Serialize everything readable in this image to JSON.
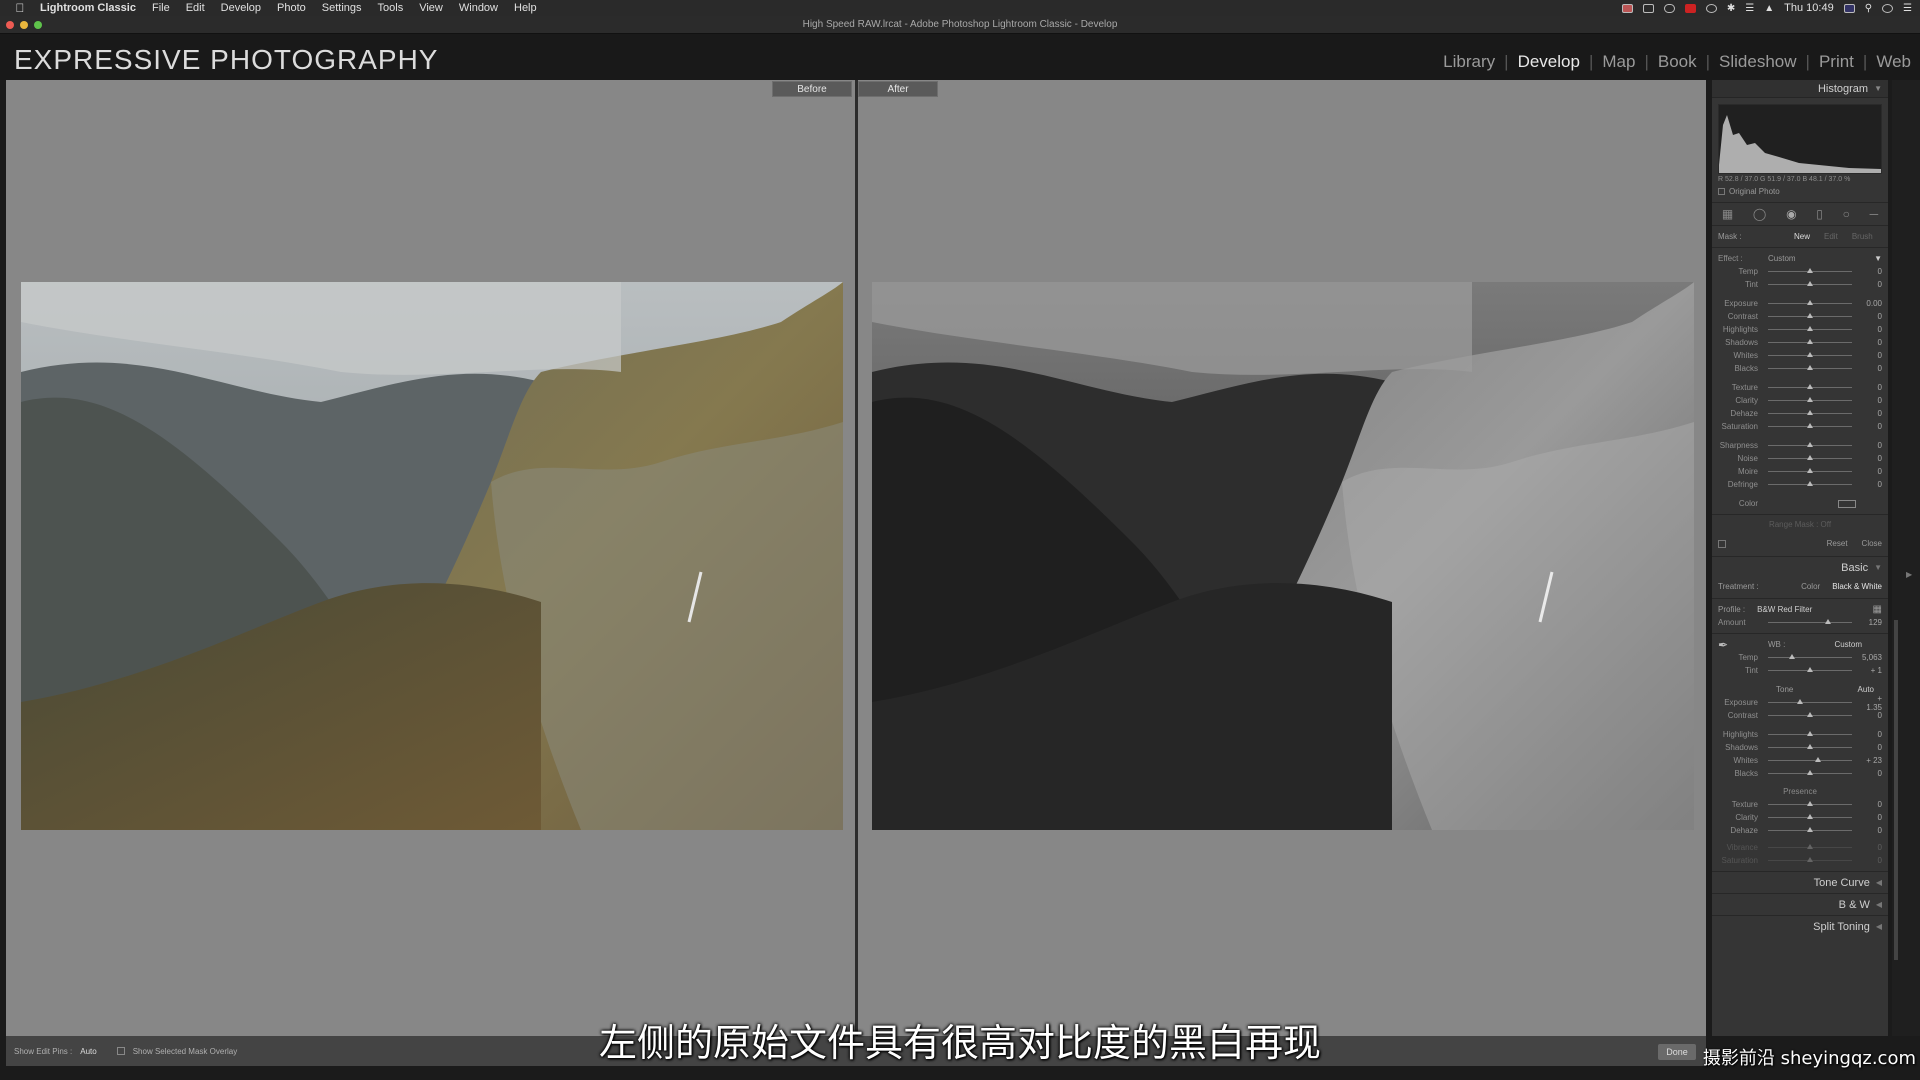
{
  "menubar": {
    "app_name": "Lightroom Classic",
    "items": [
      "File",
      "Edit",
      "Develop",
      "Photo",
      "Settings",
      "Tools",
      "View",
      "Window",
      "Help"
    ],
    "clock": "Thu 10:49"
  },
  "window": {
    "title": "High Speed RAW.lrcat - Adobe Photoshop Lightroom Classic - Develop"
  },
  "identity_plate": {
    "logo_text": "EXPRESSIVE PHOTOGRAPHY"
  },
  "modules": {
    "items": [
      "Library",
      "Develop",
      "Map",
      "Book",
      "Slideshow",
      "Print",
      "Web"
    ],
    "active": "Develop"
  },
  "view": {
    "before_label": "Before",
    "after_label": "After"
  },
  "toolbar": {
    "edit_pins_label": "Show Edit Pins :",
    "edit_pins_value": "Auto",
    "mask_overlay_label": "Show Selected Mask Overlay",
    "done_label": "Done"
  },
  "panel": {
    "histogram": {
      "title": "Histogram",
      "readout": "R 52.8 / 37.0  G 51.9 / 37.0  B 48.1 / 37.0 %",
      "original_photo_label": "Original Photo"
    },
    "mask": {
      "label": "Mask :",
      "new": "New",
      "edit": "Edit",
      "brush": "Brush",
      "effect_label": "Effect :",
      "effect_value": "Custom",
      "color_label": "Color",
      "range_mask_label": "Range Mask : Off",
      "reset_label": "Reset",
      "close_label": "Close",
      "sliders": [
        {
          "label": "Temp",
          "value": "0",
          "pos": 0.5
        },
        {
          "label": "Tint",
          "value": "0",
          "pos": 0.5
        },
        {
          "label": "Exposure",
          "value": "0.00",
          "pos": 0.5
        },
        {
          "label": "Contrast",
          "value": "0",
          "pos": 0.5
        },
        {
          "label": "Highlights",
          "value": "0",
          "pos": 0.5
        },
        {
          "label": "Shadows",
          "value": "0",
          "pos": 0.5
        },
        {
          "label": "Whites",
          "value": "0",
          "pos": 0.5
        },
        {
          "label": "Blacks",
          "value": "0",
          "pos": 0.5
        },
        {
          "label": "Texture",
          "value": "0",
          "pos": 0.5
        },
        {
          "label": "Clarity",
          "value": "0",
          "pos": 0.5
        },
        {
          "label": "Dehaze",
          "value": "0",
          "pos": 0.5
        },
        {
          "label": "Saturation",
          "value": "0",
          "pos": 0.5
        },
        {
          "label": "Sharpness",
          "value": "0",
          "pos": 0.5
        },
        {
          "label": "Noise",
          "value": "0",
          "pos": 0.5
        },
        {
          "label": "Moire",
          "value": "0",
          "pos": 0.5
        },
        {
          "label": "Defringe",
          "value": "0",
          "pos": 0.5
        }
      ]
    },
    "basic": {
      "title": "Basic",
      "treatment_label": "Treatment :",
      "treatment_color": "Color",
      "treatment_bw": "Black & White",
      "profile_label": "Profile :",
      "profile_value": "B&W Red Filter",
      "amount_label": "Amount",
      "amount_value": "129",
      "amount_pos": 0.72,
      "wb_label": "WB :",
      "wb_value": "Custom",
      "wb_sliders": [
        {
          "label": "Temp",
          "value": "5,063",
          "pos": 0.28
        },
        {
          "label": "Tint",
          "value": "+ 1",
          "pos": 0.5
        }
      ],
      "tone_label": "Tone",
      "tone_auto": "Auto",
      "tone_sliders": [
        {
          "label": "Exposure",
          "value": "+ 1.35",
          "pos": 0.38
        },
        {
          "label": "Contrast",
          "value": "0",
          "pos": 0.5
        }
      ],
      "tone_sliders2": [
        {
          "label": "Highlights",
          "value": "0",
          "pos": 0.5
        },
        {
          "label": "Shadows",
          "value": "0",
          "pos": 0.5
        },
        {
          "label": "Whites",
          "value": "+ 23",
          "pos": 0.6
        },
        {
          "label": "Blacks",
          "value": "0",
          "pos": 0.5
        }
      ],
      "presence_label": "Presence",
      "presence_sliders": [
        {
          "label": "Texture",
          "value": "0",
          "pos": 0.5
        },
        {
          "label": "Clarity",
          "value": "0",
          "pos": 0.5
        },
        {
          "label": "Dehaze",
          "value": "0",
          "pos": 0.5
        }
      ],
      "presence_dim_sliders": [
        {
          "label": "Vibrance",
          "value": "0",
          "pos": 0.5
        },
        {
          "label": "Saturation",
          "value": "0",
          "pos": 0.5
        }
      ]
    },
    "sections": [
      "Tone Curve",
      "B & W",
      "Split Toning"
    ]
  },
  "subtitle": "左侧的原始文件具有很高对比度的黑白再现",
  "watermark": "摄影前沿 sheyingqz.com"
}
